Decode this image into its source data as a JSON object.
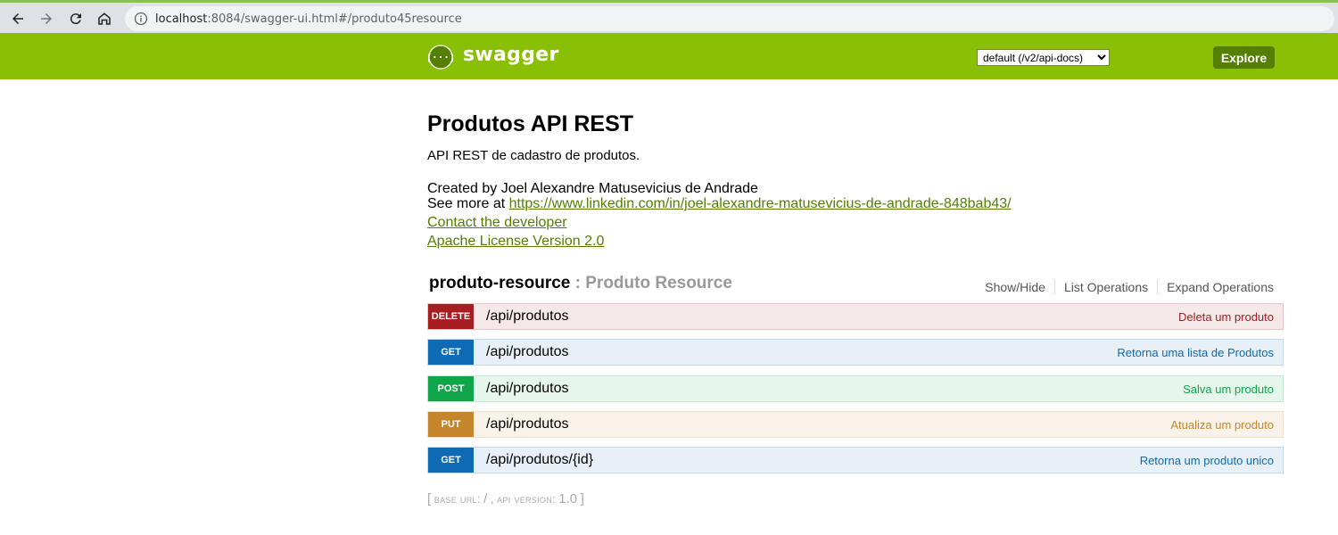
{
  "browser": {
    "url_host": "localhost",
    "url_rest": ":8084/swagger-ui.html#/produto45resource"
  },
  "header": {
    "logo_text": "swagger",
    "spec_select": "default (/v2/api-docs)",
    "explore_label": "Explore"
  },
  "info": {
    "title": "Produtos API REST",
    "description": "API REST de cadastro de produtos.",
    "created_by": "Created by Joel Alexandre Matusevicius de Andrade",
    "see_more_prefix": "See more at ",
    "see_more_link": "https://www.linkedin.com/in/joel-alexandre-matusevicius-de-andrade-848bab43/",
    "contact_link": "Contact the developer",
    "license_link": "Apache License Version 2.0"
  },
  "resource": {
    "name": "produto-resource",
    "separator": " : ",
    "description": "Produto Resource",
    "options": {
      "show_hide": "Show/Hide",
      "list_operations": "List Operations",
      "expand_operations": "Expand Operations"
    }
  },
  "operations": [
    {
      "method": "DELETE",
      "path": "/api/produtos",
      "summary": "Deleta um produto"
    },
    {
      "method": "GET",
      "path": "/api/produtos",
      "summary": "Retorna uma lista de Produtos"
    },
    {
      "method": "POST",
      "path": "/api/produtos",
      "summary": "Salva um produto"
    },
    {
      "method": "PUT",
      "path": "/api/produtos",
      "summary": "Atualiza um produto"
    },
    {
      "method": "GET",
      "path": "/api/produtos/{id}",
      "summary": "Retorna um produto unico"
    }
  ],
  "footer": {
    "open_bracket": "[",
    "base_url_label": "base url",
    "base_url_value": "/",
    "api_version_label": "api version",
    "api_version_value": "1.0",
    "close_bracket": "]"
  },
  "colors": {
    "header_bg": "#89bf04",
    "explore_bg": "#547f00",
    "delete": "#a41e22",
    "get": "#0f6ab4",
    "post": "#10a54a",
    "put": "#c5862b"
  },
  "icons": {
    "back": "arrow-left-icon",
    "forward": "arrow-right-icon",
    "reload": "reload-icon",
    "home": "home-icon",
    "info": "info-icon",
    "logo": "swagger-logo-icon"
  }
}
